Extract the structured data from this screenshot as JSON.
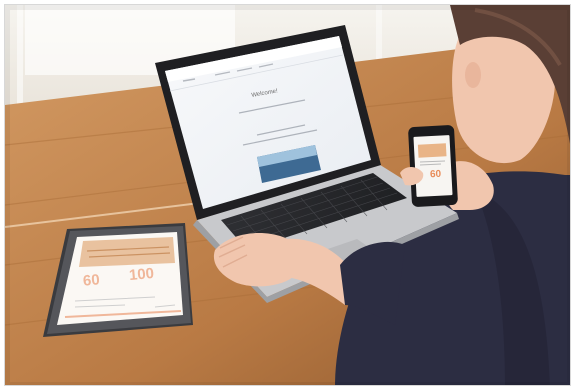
{
  "photo": {
    "colors": {
      "table_light": "#c58a56",
      "table_dark": "#8f5a2f",
      "wall": "#f1eee8",
      "laptop_body": "#c8c9cc",
      "laptop_bezel": "#1f1f22",
      "laptop_screen": "#f3f5f8",
      "keyboard": "#2a2b2e",
      "sweater": "#2c2d42",
      "skin": "#f1c6ae",
      "hair": "#5a3f35",
      "accent_orange": "#e88c5a"
    },
    "laptop_screen_text": "Welcome!",
    "tablet_numbers": [
      "60",
      "100"
    ],
    "phone_number": "60"
  }
}
